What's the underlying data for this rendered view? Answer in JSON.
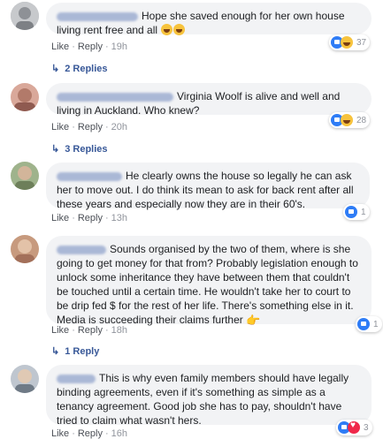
{
  "comments": [
    {
      "text": "Hope she saved enough for her own house living rent free and all",
      "actions": [
        "Like",
        "Reply",
        "19h"
      ],
      "reaction_count": "37",
      "replies": "2 Replies"
    },
    {
      "text": "Virginia Woolf is alive and well and living in Auckland. Who knew?",
      "actions": [
        "Like",
        "Reply",
        "20h"
      ],
      "reaction_count": "28",
      "replies": "3 Replies"
    },
    {
      "text": "He clearly owns the house so legally he can ask her to move out. I do think its mean to ask for back rent after all these years and especially now they are in their 60's.",
      "actions": [
        "Like",
        "Reply",
        "13h"
      ],
      "reaction_count": "1"
    },
    {
      "text": "Sounds organised by the two of them, where is she going to get money for that from? Probably legislation enough to unlock some inheritance they have between them that couldn't be touched until a certain time. He wouldn't take her to court to be drip fed $ for the rest of her life. There's something else in it. Media is succeeding their claims further",
      "actions": [
        "Like",
        "Reply",
        "18h"
      ],
      "reaction_count": "1",
      "replies": "1 Reply"
    },
    {
      "text": "This is why even family members should have legally binding agreements, even if it's something as simple as a tenancy agreement. Good job she has to pay, shouldn't have tried to claim what wasn't hers.",
      "actions": [
        "Like",
        "Reply",
        "16h"
      ],
      "reaction_count": "3"
    }
  ],
  "colors": {
    "bubble": "#f2f3f5",
    "link": "#385898",
    "like_blue": "#2e7cf6",
    "muted": "#90949c"
  }
}
